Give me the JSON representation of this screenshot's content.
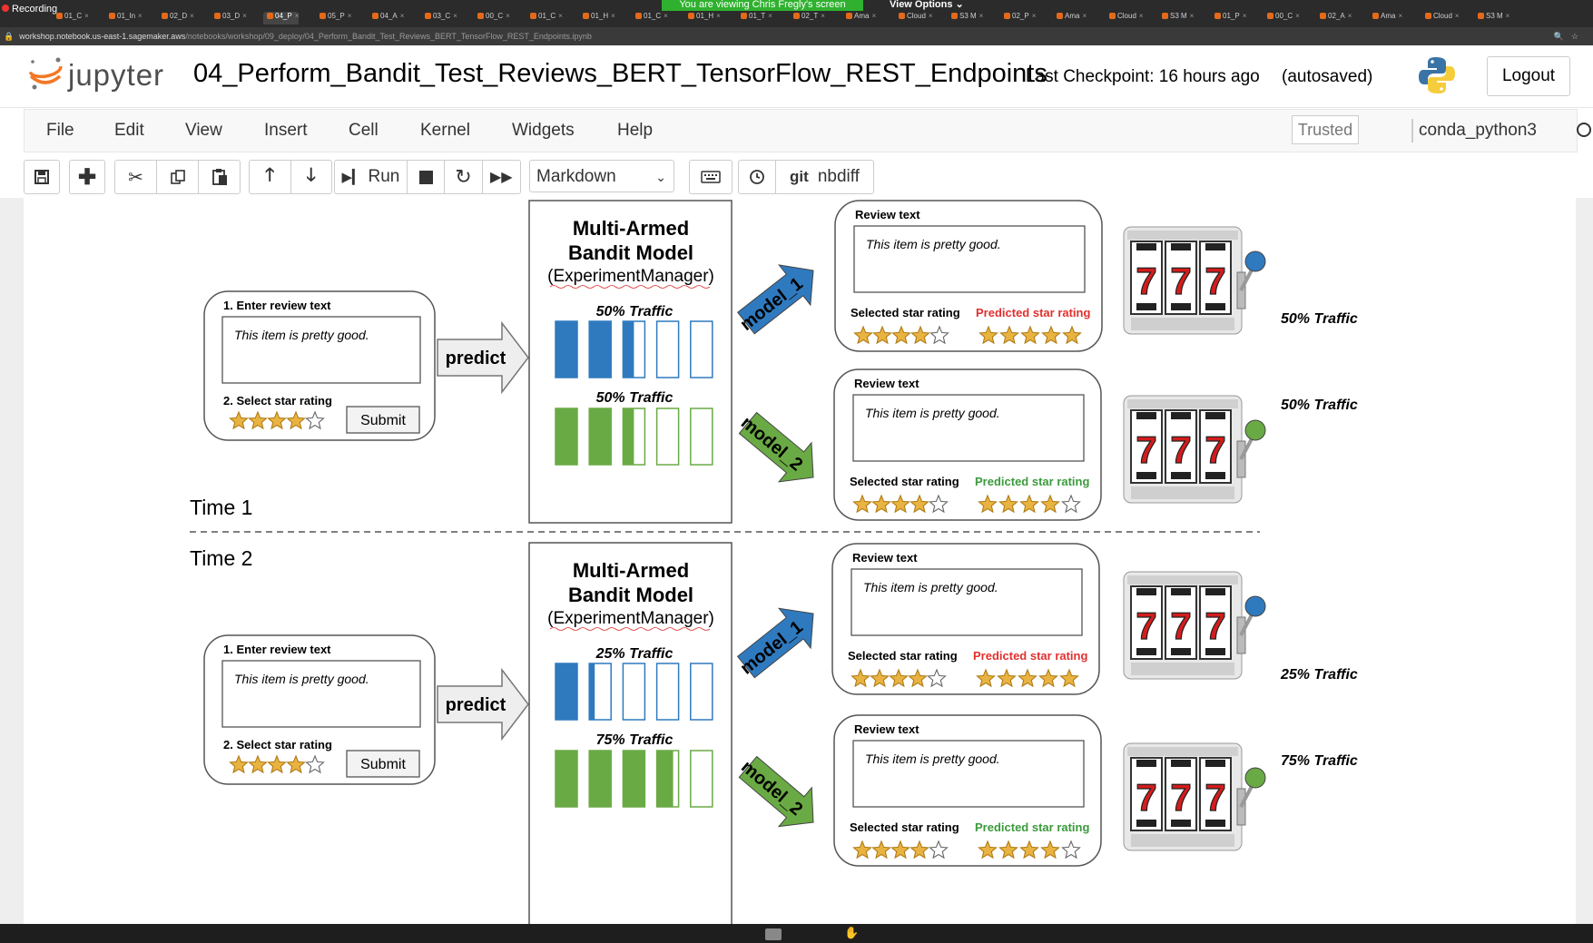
{
  "browser": {
    "recording_label": "Recording",
    "share_banner": "You are viewing Chris Fregly's screen",
    "view_options": "View Options",
    "tabs": [
      "01_C",
      "01_In",
      "02_D",
      "03_D",
      "04_P",
      "05_P",
      "04_A",
      "03_C",
      "00_C",
      "01_C",
      "01_H",
      "01_C",
      "01_H",
      "01_T",
      "02_T",
      "Ama",
      "Cloud",
      "S3 M",
      "02_P",
      "Ama",
      "Cloud",
      "S3 M",
      "01_P",
      "00_C",
      "02_A",
      "Ama",
      "Cloud",
      "S3 M"
    ],
    "url_host": "workshop.notebook.us-east-1.sagemaker.aws",
    "url_path": "/notebooks/workshop/09_deploy/04_Perform_Bandit_Test_Reviews_BERT_TensorFlow_REST_Endpoints.ipynb"
  },
  "header": {
    "brand": "jupyter",
    "notebook_title": "04_Perform_Bandit_Test_Reviews_BERT_TensorFlow_REST_Endpoints",
    "checkpoint": "Last Checkpoint: 16 hours ago",
    "autosaved": "(autosaved)",
    "logout": "Logout"
  },
  "menu": {
    "items": [
      "File",
      "Edit",
      "View",
      "Insert",
      "Cell",
      "Kernel",
      "Widgets",
      "Help"
    ],
    "trusted": "Trusted",
    "kernel": "conda_python3"
  },
  "toolbar": {
    "run_label": "Run",
    "cell_type": "Markdown",
    "nbdiff_prefix": "git",
    "nbdiff_label": "nbdiff"
  },
  "diagram": {
    "colors": {
      "blue": "#2f7abf",
      "green": "#6aaa45",
      "star": "#e9b342",
      "red_text": "#e0312f",
      "green_text": "#3c9a3c"
    },
    "time1": "Time 1",
    "time2": "Time 2",
    "input": {
      "enter_label": "1. Enter review text",
      "review_text": "This item is pretty good.",
      "select_label": "2. Select star rating",
      "submit": "Submit",
      "stars": 4
    },
    "predict": "predict",
    "model_box": {
      "title_line1": "Multi-Armed",
      "title_line2": "Bandit Model",
      "subtitle": "(ExperimentManager)"
    },
    "models": [
      "model_1",
      "model_2"
    ],
    "review_card": {
      "review_label": "Review text",
      "review_text": "This item is pretty good.",
      "selected_label": "Selected star rating",
      "predicted_label": "Predicted star rating"
    },
    "time1_data": {
      "model1_traffic": "50% Traffic",
      "model2_traffic": "50% Traffic",
      "model1_fill": 0.5,
      "model2_fill": 0.5,
      "model1_selected_stars": 4,
      "model1_predicted_stars": 5,
      "model2_selected_stars": 4,
      "model2_predicted_stars": 4
    },
    "time2_data": {
      "model1_traffic": "25% Traffic",
      "model2_traffic": "75% Traffic",
      "model1_fill": 0.25,
      "model2_fill": 0.75,
      "model1_selected_stars": 4,
      "model1_predicted_stars": 5,
      "model2_selected_stars": 4,
      "model2_predicted_stars": 4
    },
    "slot_reels": "777"
  }
}
